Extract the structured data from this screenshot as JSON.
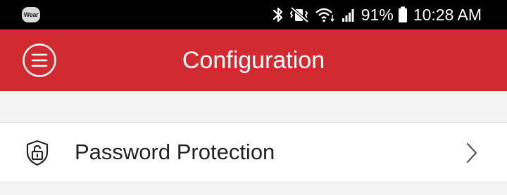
{
  "status_bar": {
    "wear_label": "Wear",
    "battery_percent": "91%",
    "time": "10:28 AM",
    "icons": [
      "bluetooth-icon",
      "vibrate-mute-icon",
      "wifi-icon",
      "signal-icon",
      "battery-icon"
    ]
  },
  "app_bar": {
    "title": "Configuration",
    "menu_icon": "menu-icon",
    "background_color": "#d02b31"
  },
  "list": {
    "items": [
      {
        "label": "Password Protection",
        "icon": "shield-lock-icon",
        "trailing_icon": "chevron-right-icon"
      }
    ]
  }
}
